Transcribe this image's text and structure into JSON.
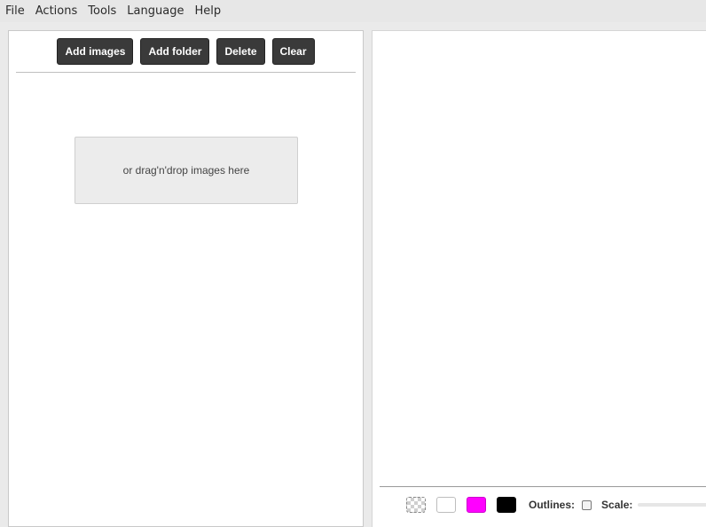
{
  "menu": [
    "File",
    "Actions",
    "Tools",
    "Language",
    "Help"
  ],
  "toolbar": {
    "add_images": "Add images",
    "add_folder": "Add folder",
    "delete": "Delete",
    "clear": "Clear"
  },
  "dropzone": {
    "text": "or drag'n'drop images here"
  },
  "bottom_bar": {
    "backgrounds": [
      {
        "name": "transparent",
        "color": "checker"
      },
      {
        "name": "white",
        "color": "#ffffff"
      },
      {
        "name": "magenta",
        "color": "#ff00ff"
      },
      {
        "name": "black",
        "color": "#000000"
      }
    ],
    "outlines_label": "Outlines:",
    "outlines_checked": false,
    "scale_label": "Scale:"
  }
}
